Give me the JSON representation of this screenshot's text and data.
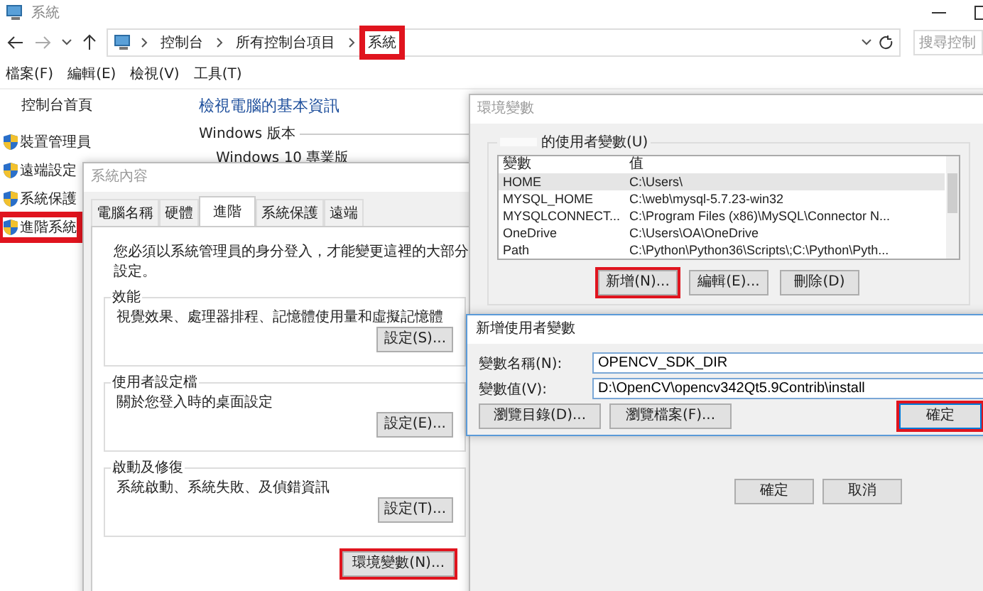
{
  "window": {
    "title": "系統"
  },
  "nav": {
    "breadcrumb": [
      {
        "label": "控制台",
        "highlighted": false
      },
      {
        "label": "所有控制台項目",
        "highlighted": false
      },
      {
        "label": "系統",
        "highlighted": true
      }
    ],
    "search": {
      "placeholder": "搜尋控制"
    }
  },
  "menu": [
    "檔案(F)",
    "編輯(E)",
    "檢視(V)",
    "工具(T)"
  ],
  "sidebar": {
    "home": "控制台首頁",
    "items": [
      {
        "label": "裝置管理員",
        "highlighted": false
      },
      {
        "label": "遠端設定",
        "highlighted": false
      },
      {
        "label": "系統保護",
        "highlighted": false
      },
      {
        "label": "進階系統",
        "highlighted": true
      }
    ]
  },
  "content": {
    "heading": "檢視電腦的基本資訊",
    "section": "Windows 版本",
    "edition": "Windows 10 專業版"
  },
  "system_properties": {
    "title": "系統內容",
    "tabs": [
      {
        "label": "電腦名稱",
        "selected": false
      },
      {
        "label": "硬體",
        "selected": false
      },
      {
        "label": "進階",
        "selected": true
      },
      {
        "label": "系統保護",
        "selected": false
      },
      {
        "label": "遠端",
        "selected": false
      }
    ],
    "note": "您必須以系統管理員的身分登入，才能變更這裡的大部分設定。",
    "groups": [
      {
        "title": "效能",
        "description": "視覺效果、處理器排程、記憶體使用量和虛擬記憶體",
        "button": "設定(S)..."
      },
      {
        "title": "使用者設定檔",
        "description": "關於您登入時的桌面設定",
        "button": "設定(E)..."
      },
      {
        "title": "啟動及修復",
        "description": "系統啟動、系統失敗、及偵錯資訊",
        "button": "設定(T)..."
      }
    ],
    "env_button": {
      "label": "環境變數(N)...",
      "highlighted": true
    }
  },
  "environment_variables": {
    "title": "環境變數",
    "user_group_label": "的使用者變數(U)",
    "columns": [
      "變數",
      "值"
    ],
    "rows": [
      {
        "name": "HOME",
        "value": "C:\\Users\\",
        "selected": true
      },
      {
        "name": "MYSQL_HOME",
        "value": "C:\\web\\mysql-5.7.23-win32",
        "selected": false
      },
      {
        "name": "MYSQLCONNECT...",
        "value": "C:\\Program Files (x86)\\MySQL\\Connector N...",
        "selected": false
      },
      {
        "name": "OneDrive",
        "value": "C:\\Users\\OA\\OneDrive",
        "selected": false
      },
      {
        "name": "Path",
        "value": "C:\\Python\\Python36\\Scripts\\;C:\\Python\\Pyth...",
        "selected": false
      }
    ],
    "buttons": [
      {
        "label": "新增(N)...",
        "highlighted": true
      },
      {
        "label": "編輯(E)...",
        "highlighted": false
      },
      {
        "label": "刪除(D)",
        "highlighted": false
      }
    ],
    "footer_buttons": [
      "確定",
      "取消"
    ]
  },
  "new_variable_dialog": {
    "title": "新增使用者變數",
    "fields": [
      {
        "label": "變數名稱(N):",
        "value": "OPENCV_SDK_DIR"
      },
      {
        "label": "變數值(V):",
        "value": "D:\\OpenCV\\opencv342Qt5.9Contrib\\install"
      }
    ],
    "buttons": [
      {
        "label": "瀏覽目錄(D)...",
        "highlighted": false
      },
      {
        "label": "瀏覽檔案(F)...",
        "highlighted": false
      },
      {
        "label": "確定",
        "highlighted": true
      }
    ]
  }
}
